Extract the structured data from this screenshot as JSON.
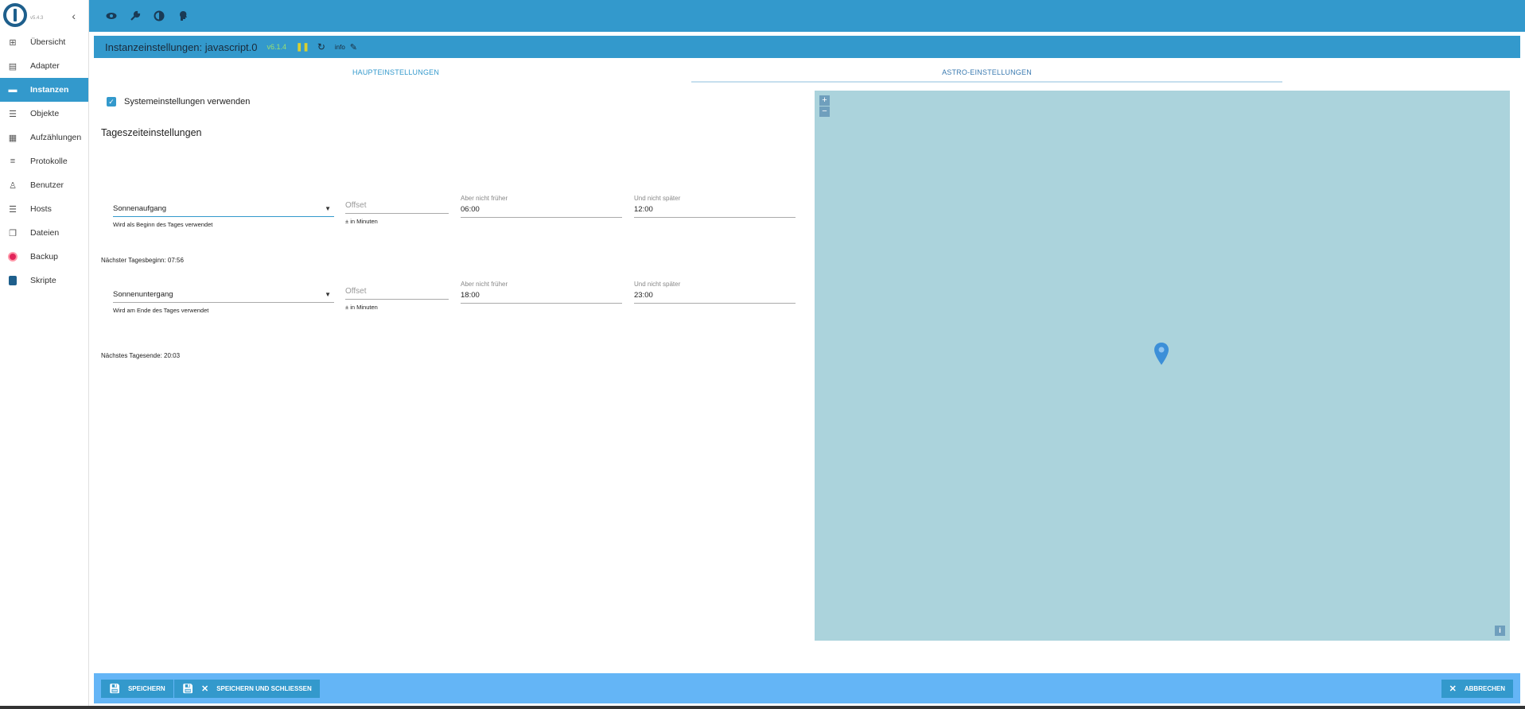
{
  "logo": {
    "version": "v5.4.3"
  },
  "sidebar": {
    "items": [
      {
        "label": "Übersicht",
        "icon": "grid-icon"
      },
      {
        "label": "Adapter",
        "icon": "store-icon"
      },
      {
        "label": "Instanzen",
        "icon": "instances-icon",
        "active": true
      },
      {
        "label": "Objekte",
        "icon": "list-icon"
      },
      {
        "label": "Aufzählungen",
        "icon": "enum-icon"
      },
      {
        "label": "Protokolle",
        "icon": "log-icon"
      },
      {
        "label": "Benutzer",
        "icon": "user-icon"
      },
      {
        "label": "Hosts",
        "icon": "hosts-icon"
      },
      {
        "label": "Dateien",
        "icon": "files-icon"
      },
      {
        "label": "Backup",
        "icon": "backup-icon"
      },
      {
        "label": "Skripte",
        "icon": "scripts-icon"
      }
    ]
  },
  "topbar": {
    "icons": [
      "eye-icon",
      "wrench-icon",
      "contrast-icon",
      "expert-icon"
    ]
  },
  "dialog": {
    "title": "Instanzeinstellungen: javascript.0",
    "version": "v6.1.4",
    "info_label": "info"
  },
  "tabs": [
    {
      "label": "Haupteinstellungen"
    },
    {
      "label": "Astro-Einstellungen",
      "active": true
    }
  ],
  "settings": {
    "use_system_label": "Systemeinstellungen verwenden",
    "section_title": "Tageszeiteinstellungen",
    "sunrise": {
      "select_value": "Sonnenaufgang",
      "select_helper": "Wird als Beginn des Tages verwendet",
      "offset_placeholder": "Offset",
      "offset_helper": "± in Minuten",
      "not_earlier_label": "Aber nicht früher",
      "not_earlier_value": "06:00",
      "not_later_label": "Und nicht später",
      "not_later_value": "12:00",
      "next_note": "Nächster Tagesbeginn: 07:56"
    },
    "sunset": {
      "select_value": "Sonnenuntergang",
      "select_helper": "Wird am Ende des Tages verwendet",
      "offset_placeholder": "Offset",
      "offset_helper": "± in Minuten",
      "not_earlier_label": "Aber nicht früher",
      "not_earlier_value": "18:00",
      "not_later_label": "Und nicht später",
      "not_later_value": "23:00",
      "next_note": "Nächstes Tagesende: 20:03"
    }
  },
  "map": {
    "zoom_in": "+",
    "zoom_out": "−",
    "info": "i"
  },
  "footer": {
    "save": "Speichern",
    "save_close": "Speichern und schließen",
    "cancel": "Abbrechen"
  }
}
